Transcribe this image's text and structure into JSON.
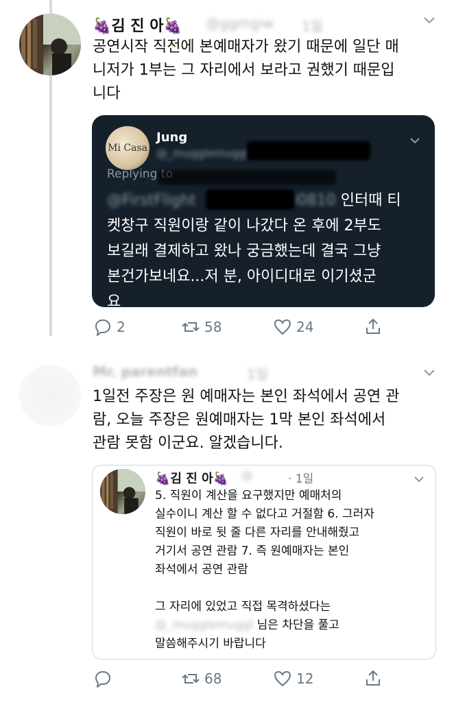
{
  "tweet1": {
    "name": "🍇김 진 아🍇",
    "handle": "@",
    "time": "1일",
    "text_lines": [
      "공연시작 직전에 본예매자가 왔기 때문에 일단 매",
      "니저가 1부는 그 자리에서 보라고 권했기 때문입",
      "니다"
    ],
    "quoted": {
      "avatar_label": "Mi Casa",
      "name": "Jung",
      "handle": "@_mugglemuggl",
      "replying": "Replying to",
      "mention": "@FirstFlight",
      "mention2": "00810",
      "text_lines": [
        "인터때 티",
        "켓창구 직원이랑 같이 나갔다 온 후에 2부도",
        "보길래 결제하고 왔나 궁금했는데 결국 그냥",
        "본건가보네요...저 분, 아이디대로 이기셨군",
        "요"
      ]
    },
    "actions": {
      "reply": "2",
      "retweet": "58",
      "like": "24"
    }
  },
  "tweet2": {
    "name": "Mr. parentfan",
    "time": "1일",
    "text_lines": [
      "1일전 주장은 원 예매자는 본인 좌석에서 공연 관",
      "람, 오늘 주장은 원예매자는 1막 본인 좌석에서",
      "관람 못함 이군요. 알겠습니다."
    ],
    "quoted": {
      "name": "🍇김 진 아🍇",
      "handle": "@",
      "time": "· 1일",
      "text_lines": [
        "5. 직원이 계산을 요구했지만 예매처의",
        "실수이니 계산 할 수 없다고 거절함 6. 그러자",
        "직원이 바로 뒷 줄 다른 자리를 안내해줬고",
        "거기서 공연 관람 7. 즉 원예매자는 본인",
        "좌석에서 공연 관람",
        "",
        "그 자리에 있었고 직접 목격하셨다는",
        "님은 차단을 풀고",
        "말씀해주시기 바랍니다"
      ],
      "mention": "@_mugglemuggl"
    },
    "actions": {
      "reply": "",
      "retweet": "68",
      "like": "12"
    }
  }
}
